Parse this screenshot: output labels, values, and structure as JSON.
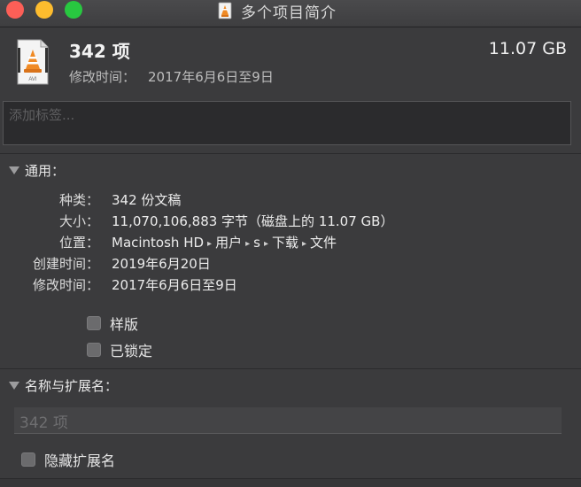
{
  "window": {
    "title": "多个项目简介"
  },
  "summary": {
    "count": "342 项",
    "modified_label": "修改时间：",
    "modified_value": "2017年6月6日至9日",
    "total_size": "11.07 GB"
  },
  "tags": {
    "placeholder": "添加标签..."
  },
  "general": {
    "header": "通用：",
    "rows": [
      {
        "label": "种类：",
        "value": "342 份文稿"
      },
      {
        "label": "大小：",
        "value": "11,070,106,883 字节（磁盘上的 11.07 GB）"
      },
      {
        "label": "位置：",
        "path": [
          "Macintosh HD",
          "用户",
          "s",
          "下载",
          "文件"
        ]
      },
      {
        "label": "创建时间：",
        "value": "2019年6月20日"
      },
      {
        "label": "修改时间：",
        "value": "2017年6月6日至9日"
      }
    ],
    "checkboxes": [
      {
        "label": "样版",
        "checked": false
      },
      {
        "label": "已锁定",
        "checked": false
      }
    ]
  },
  "name_ext": {
    "header": "名称与扩展名：",
    "field_placeholder": "342 项",
    "hide_ext_label": "隐藏扩展名",
    "hide_ext_checked": false
  },
  "icons": {
    "file_icon": "vlc-document-icon",
    "section_toggle": "disclosure-triangle-icon"
  }
}
